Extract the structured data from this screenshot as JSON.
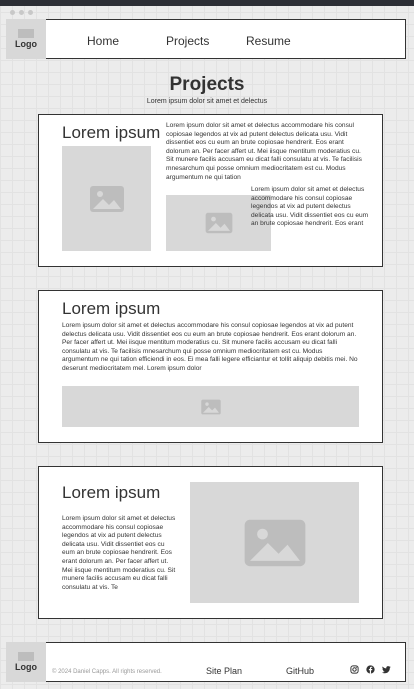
{
  "header": {
    "logo": "Logo",
    "nav": [
      "Home",
      "Projects",
      "Resume"
    ]
  },
  "page": {
    "title": "Projects",
    "subtitle": "Lorem ipsum dolor sit amet et delectus"
  },
  "project1": {
    "title": "Lorem ipsum",
    "text_top": "Lorem ipsum dolor sit amet et delectus accommodare his consul copiosae legendos at vix ad putent delectus delicata usu. Vidit dissentiet eos cu eum an brute copiosae hendrerit. Eos erant dolorum an. Per facer affert ut. Mei iisque mentitum moderatius cu. Sit munere facilis accusam eu dicat falli consulatu at vis. Te facilisis mnesarchum qui posse omnium mediocritatem est cu. Modus argumentum ne qui tation",
    "text_side": "Lorem ipsum dolor sit amet et delectus accommodare his consul copiosae legendos at vix ad putent delectus delicata usu. Vidit dissentiet eos cu eum an brute copiosae hendrerit. Eos erant"
  },
  "project2": {
    "title": "Lorem ipsum",
    "text": "Lorem ipsum dolor sit amet et delectus accommodare his consul copiosae legendos at vix ad putent delectus delicata usu. Vidit dissentiet eos cu eum an brute copiosae hendrerit. Eos erant dolorum an. Per facer affert ut. Mei iisque mentitum moderatius cu. Sit munere facilis accusam eu dicat falli consulatu at vis. Te facilisis mnesarchum qui posse omnium mediocritatem est cu. Modus argumentum ne qui tation efficiendi in eos. Ei mea falli legere efficiantur et tollit aliquip debitis mei. No deserunt mediocritatem mel. Lorem ipsum dolor"
  },
  "project3": {
    "title": "Lorem ipsum",
    "text": "Lorem ipsum dolor sit amet et delectus accommodare his consul copiosae legendos at vix ad putent delectus delicata usu. Vidit dissentiet eos cu eum an brute copiosae hendrerit. Eos erant dolorum an. Per facer affert ut. Mei iisque mentitum moderatius cu. Sit munere facilis accusam eu dicat falli consulatu at vis. Te"
  },
  "footer": {
    "logo": "Logo",
    "copyright": "© 2024 Daniel Capps. All rights reserved.",
    "links": [
      "Site Plan",
      "GitHub"
    ],
    "social_icons": [
      "instagram-icon",
      "facebook-icon",
      "twitter-icon"
    ]
  },
  "colors": {
    "placeholder": "#d8d8d8",
    "placeholder_icon": "#bdbdbd",
    "border": "#333333",
    "topbar": "#2d2f36"
  }
}
